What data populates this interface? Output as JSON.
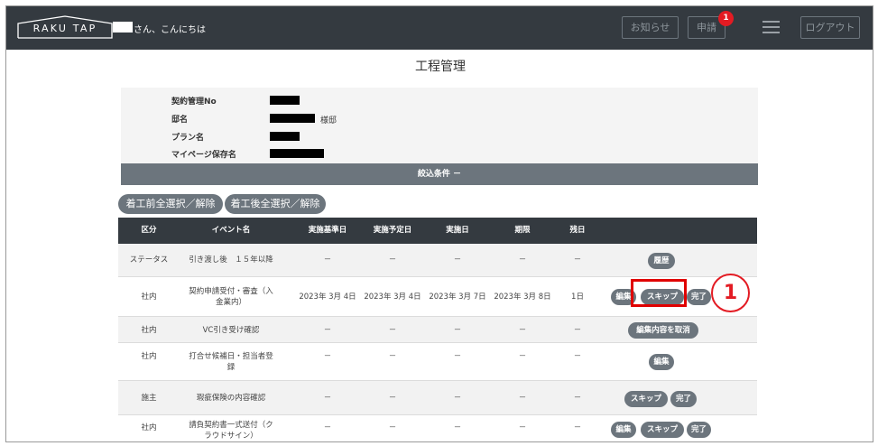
{
  "header": {
    "logo": "RAKU TAP",
    "greeting": "さん、こんにちは",
    "notice_label": "お知らせ",
    "apply_label": "申請",
    "apply_badge": "1",
    "logout_label": "ログアウト"
  },
  "page_title": "工程管理",
  "info": {
    "contract_no_label": "契約管理No",
    "house_label": "邸名",
    "house_suffix": "様邸",
    "plan_label": "プラン名",
    "mypage_label": "マイページ保存名"
  },
  "filter_label": "絞込条件 －",
  "select_buttons": [
    "着工前全選択／解除",
    "着工後全選択／解除"
  ],
  "table": {
    "headers": [
      "区分",
      "イベント名",
      "実施基準日",
      "実施予定日",
      "実施日",
      "期限",
      "残日"
    ],
    "rows": [
      {
        "category": "ステータス",
        "event": "引き渡し後　１５年以降",
        "base": "－",
        "planned": "－",
        "done": "－",
        "deadline": "－",
        "remaining": "－",
        "actions": [
          "履歴"
        ]
      },
      {
        "category": "社内",
        "event": "契約申請受付・審査（入金業内）",
        "base": "2023年 3月 4日",
        "planned": "2023年 3月 4日",
        "done": "2023年 3月 7日",
        "deadline": "2023年 3月 8日",
        "remaining": "1日",
        "actions": [
          "編集",
          "スキップ",
          "完了"
        ]
      },
      {
        "category": "社内",
        "event": "VC引き受け確認",
        "base": "－",
        "planned": "－",
        "done": "－",
        "deadline": "－",
        "remaining": "－",
        "actions": [
          "編集内容を取消"
        ]
      },
      {
        "category": "社内",
        "event": "打合せ候補日・担当者登録",
        "base": "－",
        "planned": "－",
        "done": "－",
        "deadline": "－",
        "remaining": "－",
        "actions": [
          "編集"
        ]
      },
      {
        "category": "施主",
        "event": "瑕疵保険の内容確認",
        "base": "－",
        "planned": "－",
        "done": "－",
        "deadline": "－",
        "remaining": "－",
        "actions": [
          "スキップ",
          "完了"
        ]
      },
      {
        "category": "社内",
        "event": "請負契約書一式送付（クラウドサイン）",
        "base": "－",
        "planned": "－",
        "done": "－",
        "deadline": "－",
        "remaining": "－",
        "actions": [
          "編集",
          "スキップ",
          "完了"
        ]
      }
    ]
  },
  "callout_number": "1",
  "colors": {
    "header_bg": "#343a40",
    "button_gray": "#6c757d",
    "badge_red": "#e31b23",
    "highlight_red": "#e00000"
  }
}
